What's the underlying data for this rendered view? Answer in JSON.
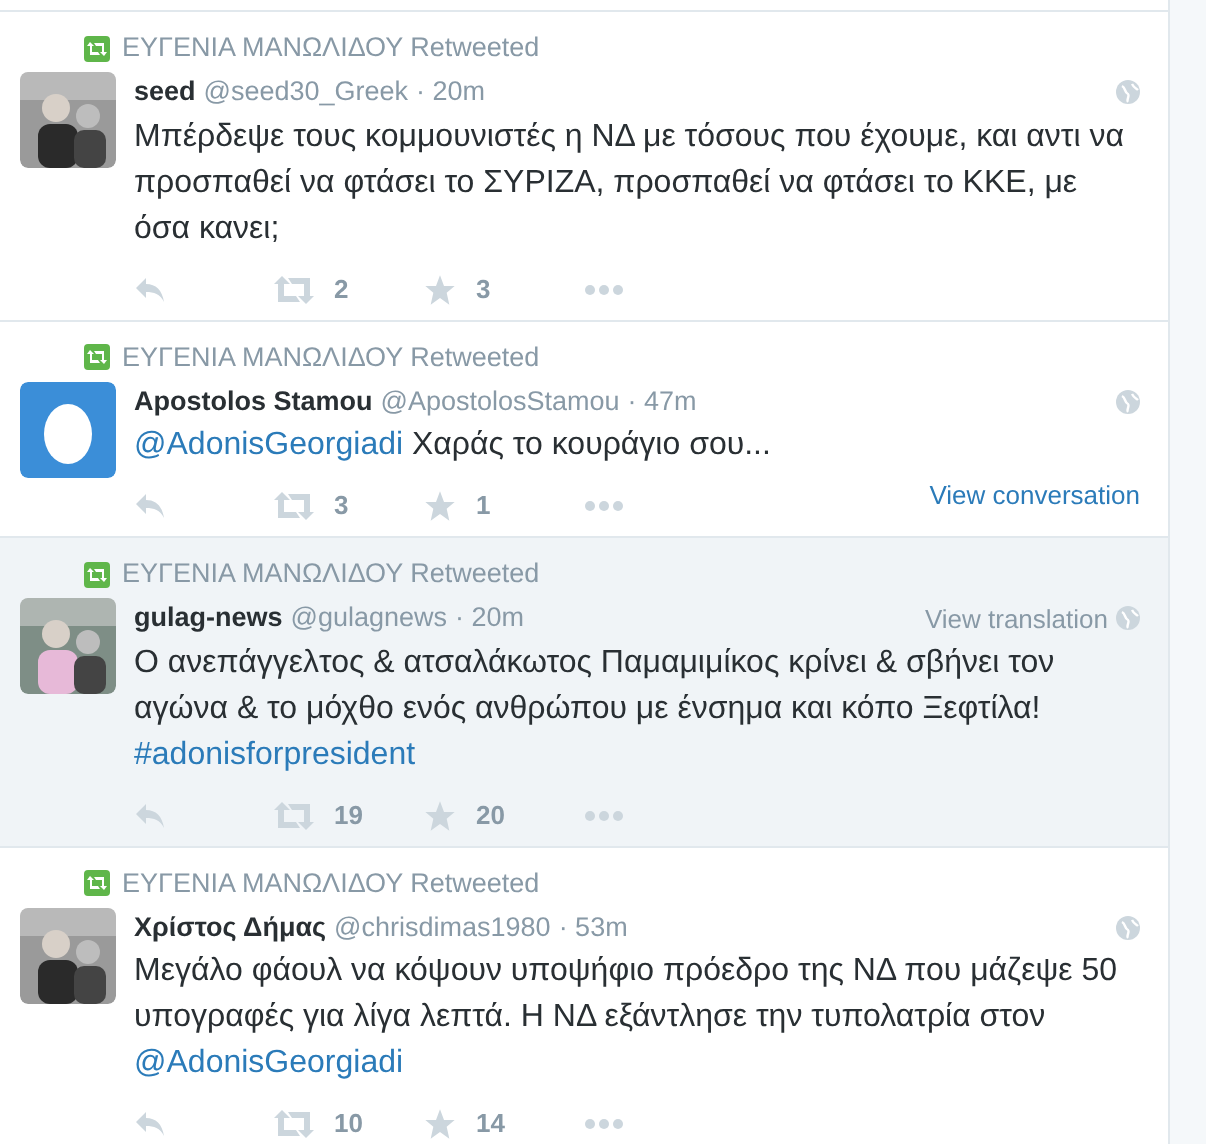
{
  "tweets": [
    {
      "retweet_label": "ΕΥΓΕΝΙΑ ΜΑΝΩΛΙΔΟΥ Retweeted",
      "name": "seed",
      "handle": "@seed30_Greek",
      "time": "· 20m",
      "avatar": {
        "kind": "picture"
      },
      "highlighted": false,
      "body": [
        {
          "kind": "text",
          "text": "Μπέρδεψε τους κομμουνιστές η ΝΔ με τόσους που έχουμε, και αντι να προσπαθεί να φτάσει το ΣΥΡΙΖΑ, προσπαθεί να φτάσει το ΚΚΕ, με όσα κανει;"
        }
      ],
      "retweets": "2",
      "favorites": "3"
    },
    {
      "retweet_label": "ΕΥΓΕΝΙΑ ΜΑΝΩΛΙΔΟΥ Retweeted",
      "name": "Apostolos Stamou",
      "handle": "@ApostolosStamou",
      "time": "· 47m",
      "avatar": {
        "kind": "egg"
      },
      "highlighted": false,
      "body": [
        {
          "kind": "link",
          "text": "@AdonisGeorgiadi"
        },
        {
          "kind": "text",
          "text": " Χαράς το κουράγιο σου..."
        }
      ],
      "retweets": "3",
      "favorites": "1",
      "footer_link": "View conversation"
    },
    {
      "retweet_label": "ΕΥΓΕΝΙΑ ΜΑΝΩΛΙΔΟΥ Retweeted",
      "name": "gulag-news",
      "handle": "@gulagnews",
      "time": "· 20m",
      "avatar": {
        "kind": "picture"
      },
      "highlighted": true,
      "header_link": "View translation",
      "body": [
        {
          "kind": "text",
          "text": "Ο ανεπάγγελτος & ατσαλάκωτος Παμαμιμίκος κρίνει & σβήνει τον αγώνα & το μόχθο ενός ανθρώπου με ένσημα και κόπο Ξεφτίλα! "
        },
        {
          "kind": "link",
          "text": "#adonisforpresident"
        }
      ],
      "retweets": "19",
      "favorites": "20"
    },
    {
      "retweet_label": "ΕΥΓΕΝΙΑ ΜΑΝΩΛΙΔΟΥ Retweeted",
      "name": "Χρίστος Δήμας",
      "handle": "@chrisdimas1980",
      "time": "· 53m",
      "avatar": {
        "kind": "picture"
      },
      "highlighted": false,
      "body": [
        {
          "kind": "text",
          "text": "Μεγάλο φάουλ να κόψουν υποψήφιο πρόεδρο της ΝΔ που μάζεψε 50 υπογραφές για λίγα λεπτά. Η ΝΔ εξάντλησε την τυπολατρία στον "
        },
        {
          "kind": "link",
          "text": "@AdonisGeorgiadi"
        }
      ],
      "retweets": "10",
      "favorites": "14"
    }
  ]
}
